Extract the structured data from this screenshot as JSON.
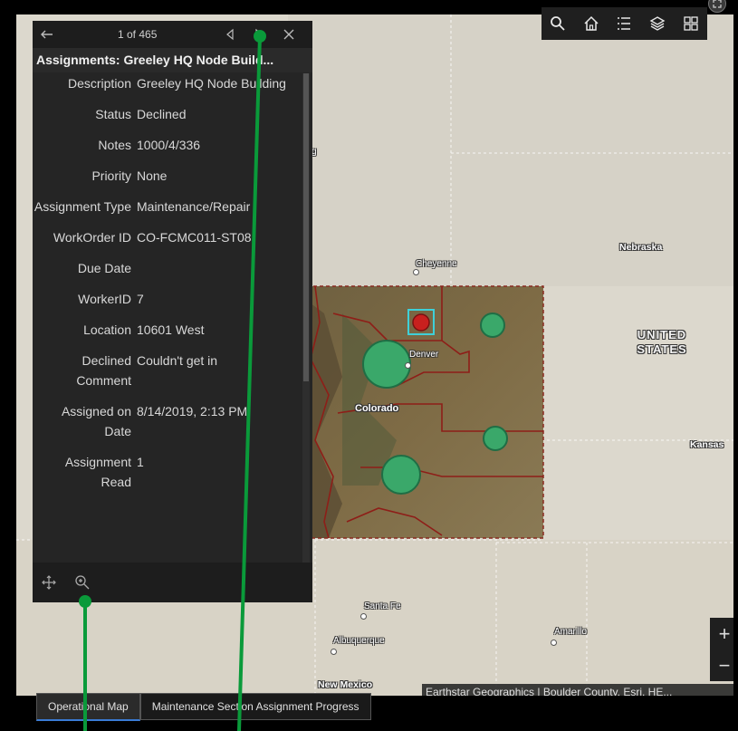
{
  "popup": {
    "counter": "1 of 465",
    "title": "Assignments: Greeley HQ Node Build...",
    "fields": [
      {
        "label": "Description",
        "value": "Greeley HQ Node Building"
      },
      {
        "label": "Status",
        "value": "Declined"
      },
      {
        "label": "Notes",
        "value": "1000/4/336"
      },
      {
        "label": "Priority",
        "value": "None"
      },
      {
        "label": "Assignment Type",
        "value": "Maintenance/Repair"
      },
      {
        "label": "WorkOrder ID",
        "value": "CO-FCMC011-ST08"
      },
      {
        "label": "Due Date",
        "value": ""
      },
      {
        "label": "WorkerID",
        "value": "7"
      },
      {
        "label": "Location",
        "value": "10601 West"
      },
      {
        "label": "Declined Comment",
        "value": "Couldn't get in"
      },
      {
        "label": "Assigned on Date",
        "value": "8/14/2019, 2:13 PM"
      },
      {
        "label": "Assignment Read",
        "value": "1"
      }
    ],
    "icons": [
      "back-arrow",
      "previous",
      "next",
      "close",
      "dock",
      "zoom-to"
    ]
  },
  "toolbar": {
    "icons": [
      "search",
      "home",
      "legend",
      "layers",
      "basemap-gallery"
    ]
  },
  "map": {
    "labels": {
      "nebraska": "Nebraska",
      "cheyenne": "Cheyenne",
      "denver": "Denver",
      "colorado": "Colorado",
      "united_states": "UNITED STATES",
      "kansas": "Kansas",
      "santa_fe": "Santa Fe",
      "amarillo": "Amarillo",
      "albuquerque": "Albuquerque",
      "new_mexico": "New Mexico",
      "partial_g": "g"
    },
    "attribution": "Earthstar Geographics | Boulder County, Esri, HE...",
    "zoom_in": "+",
    "zoom_out": "−"
  },
  "tabs": [
    {
      "label": "Operational Map",
      "active": true
    },
    {
      "label": "Maintenance Section Assignment Progress",
      "active": false
    }
  ],
  "colors": {
    "cluster": "#3aa86a",
    "selected_point": "#c8201e",
    "highlight": "#3ed0d8",
    "annotation": "#0a9a3a"
  }
}
